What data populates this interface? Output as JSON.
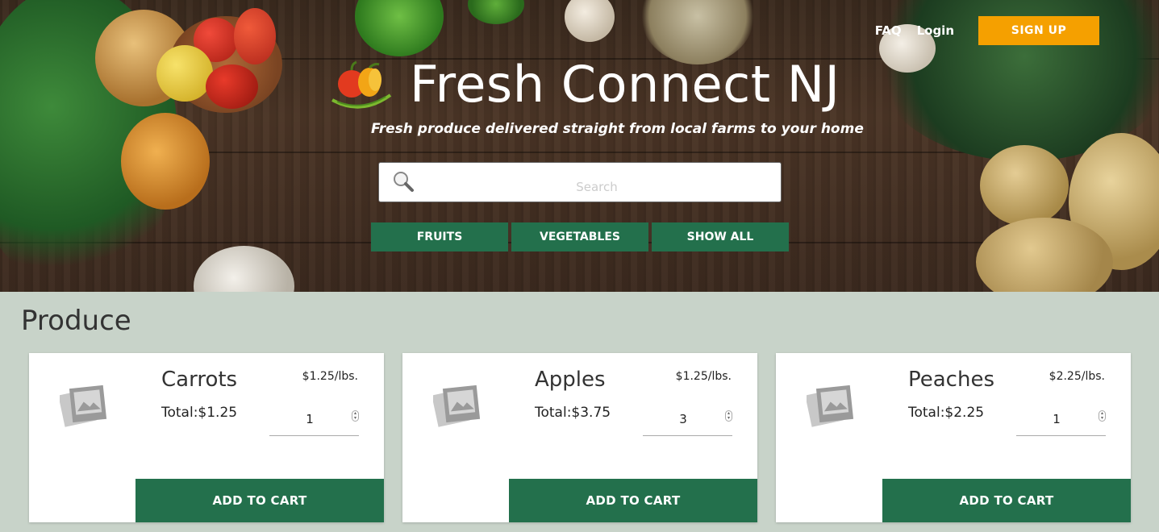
{
  "nav": {
    "faq": "FAQ",
    "login": "Login",
    "signup": "SIGN UP"
  },
  "brand": {
    "title": "Fresh Connect NJ",
    "tagline": "Fresh produce delivered straight from local farms to your home"
  },
  "search": {
    "placeholder": "Search",
    "icon": "search-icon"
  },
  "filters": {
    "fruits": "FRUITS",
    "vegetables": "VEGETABLES",
    "show_all": "SHOW ALL"
  },
  "produce": {
    "heading": "Produce",
    "items": [
      {
        "name": "Carrots",
        "price": "$1.25/lbs.",
        "total": "Total:$1.25",
        "qty": "1",
        "cta": "ADD TO CART"
      },
      {
        "name": "Apples",
        "price": "$1.25/lbs.",
        "total": "Total:$3.75",
        "qty": "3",
        "cta": "ADD TO CART"
      },
      {
        "name": "Peaches",
        "price": "$2.25/lbs.",
        "total": "Total:$2.25",
        "qty": "1",
        "cta": "ADD TO CART"
      }
    ]
  },
  "colors": {
    "primary": "#23704c",
    "accent": "#f5a000",
    "page_bg": "#c8d3c9"
  }
}
